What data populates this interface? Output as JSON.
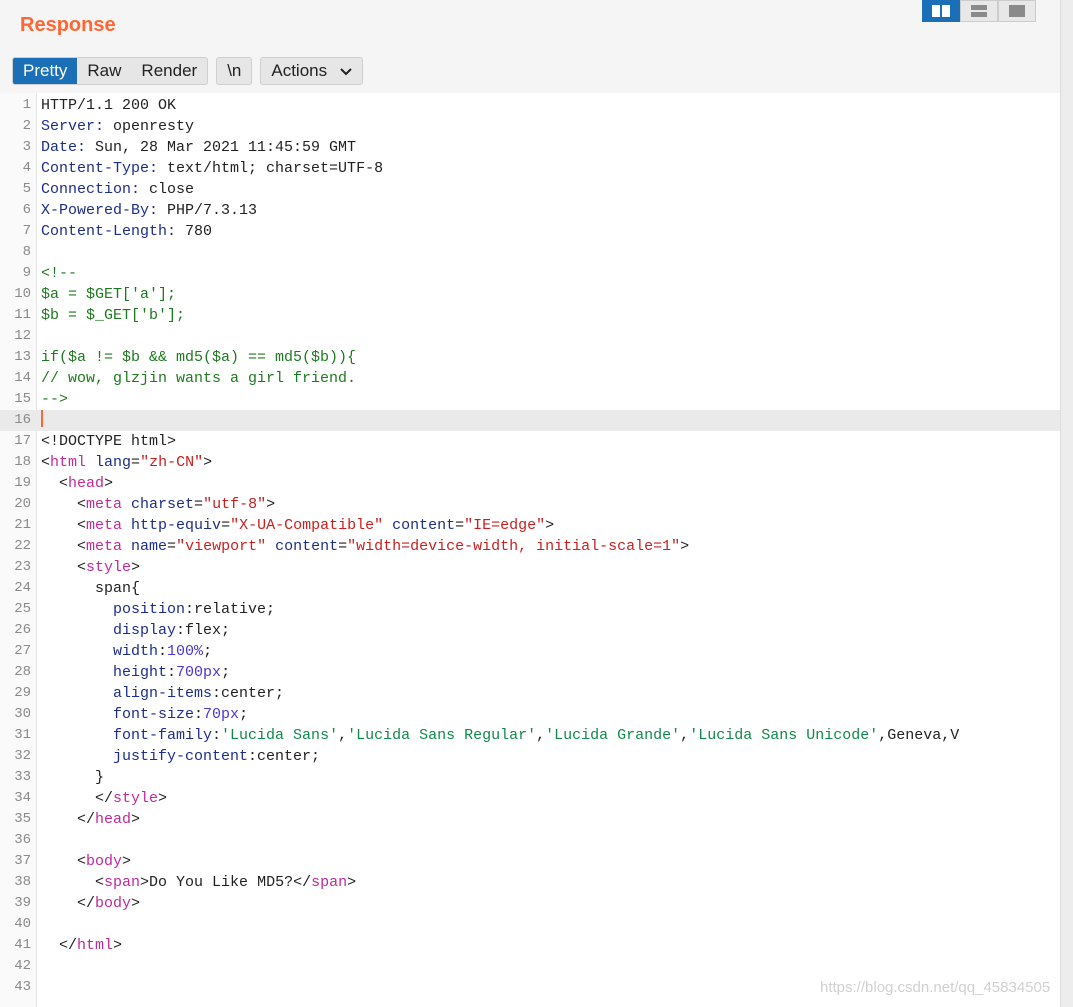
{
  "header": {
    "title": "Response",
    "layout_buttons": [
      "layout-columns-icon",
      "layout-rows-icon",
      "layout-single-icon"
    ]
  },
  "tabs": {
    "pretty": "Pretty",
    "raw": "Raw",
    "render": "Render",
    "newline": "\\n",
    "actions": "Actions"
  },
  "colors": {
    "accent": "#ff6633",
    "active_tab": "#1a6fb6"
  },
  "editor": {
    "current_line": 16,
    "lines": [
      {
        "n": "1",
        "segs": [
          [
            "t-txt",
            "HTTP/1.1 200 OK"
          ]
        ]
      },
      {
        "n": "2",
        "segs": [
          [
            "t-hkey",
            "Server:"
          ],
          [
            "t-txt",
            " openresty"
          ]
        ]
      },
      {
        "n": "3",
        "segs": [
          [
            "t-hkey",
            "Date:"
          ],
          [
            "t-txt",
            " Sun, 28 Mar 2021 11:45:59 GMT"
          ]
        ]
      },
      {
        "n": "4",
        "segs": [
          [
            "t-hkey",
            "Content-Type:"
          ],
          [
            "t-txt",
            " text/html; charset=UTF-8"
          ]
        ]
      },
      {
        "n": "5",
        "segs": [
          [
            "t-hkey",
            "Connection:"
          ],
          [
            "t-txt",
            " close"
          ]
        ]
      },
      {
        "n": "6",
        "segs": [
          [
            "t-hkey",
            "X-Powered-By:"
          ],
          [
            "t-txt",
            " PHP/7.3.13"
          ]
        ]
      },
      {
        "n": "7",
        "segs": [
          [
            "t-hkey",
            "Content-Length:"
          ],
          [
            "t-txt",
            " 780"
          ]
        ]
      },
      {
        "n": "8",
        "segs": []
      },
      {
        "n": "9",
        "segs": [
          [
            "t-com",
            "<!--"
          ]
        ]
      },
      {
        "n": "10",
        "segs": [
          [
            "t-com",
            "$a = $GET['a'];"
          ]
        ]
      },
      {
        "n": "11",
        "segs": [
          [
            "t-com",
            "$b = $_GET['b'];"
          ]
        ]
      },
      {
        "n": "12",
        "segs": []
      },
      {
        "n": "13",
        "segs": [
          [
            "t-com",
            "if($a != $b && md5($a) == md5($b)){"
          ]
        ]
      },
      {
        "n": "14",
        "segs": [
          [
            "t-com",
            "// wow, glzjin wants a girl friend."
          ]
        ]
      },
      {
        "n": "15",
        "segs": [
          [
            "t-com",
            "-->"
          ]
        ]
      },
      {
        "n": "16",
        "segs": []
      },
      {
        "n": "17",
        "segs": [
          [
            "t-pun",
            "<!DOCTYPE html>"
          ]
        ]
      },
      {
        "n": "18",
        "segs": [
          [
            "t-pun",
            "<"
          ],
          [
            "t-tag",
            "html"
          ],
          [
            "t-attr",
            " lang"
          ],
          [
            "t-pun",
            "="
          ],
          [
            "t-str",
            "\"zh-CN\""
          ],
          [
            "t-pun",
            ">"
          ]
        ]
      },
      {
        "n": "19",
        "segs": [
          [
            "t-pun",
            "  <"
          ],
          [
            "t-tag",
            "head"
          ],
          [
            "t-pun",
            ">"
          ]
        ]
      },
      {
        "n": "20",
        "segs": [
          [
            "t-pun",
            "    <"
          ],
          [
            "t-tag",
            "meta"
          ],
          [
            "t-attr",
            " charset"
          ],
          [
            "t-pun",
            "="
          ],
          [
            "t-str",
            "\"utf-8\""
          ],
          [
            "t-pun",
            ">"
          ]
        ]
      },
      {
        "n": "21",
        "segs": [
          [
            "t-pun",
            "    <"
          ],
          [
            "t-tag",
            "meta"
          ],
          [
            "t-attr",
            " http-equiv"
          ],
          [
            "t-pun",
            "="
          ],
          [
            "t-str",
            "\"X-UA-Compatible\""
          ],
          [
            "t-attr",
            " content"
          ],
          [
            "t-pun",
            "="
          ],
          [
            "t-str",
            "\"IE=edge\""
          ],
          [
            "t-pun",
            ">"
          ]
        ]
      },
      {
        "n": "22",
        "segs": [
          [
            "t-pun",
            "    <"
          ],
          [
            "t-tag",
            "meta"
          ],
          [
            "t-attr",
            " name"
          ],
          [
            "t-pun",
            "="
          ],
          [
            "t-str",
            "\"viewport\""
          ],
          [
            "t-attr",
            " content"
          ],
          [
            "t-pun",
            "="
          ],
          [
            "t-str",
            "\"width=device-width, initial-scale=1\""
          ],
          [
            "t-pun",
            ">"
          ]
        ]
      },
      {
        "n": "23",
        "segs": [
          [
            "t-pun",
            "    <"
          ],
          [
            "t-tag",
            "style"
          ],
          [
            "t-pun",
            ">"
          ]
        ]
      },
      {
        "n": "24",
        "segs": [
          [
            "t-txt",
            "      span{"
          ]
        ]
      },
      {
        "n": "25",
        "segs": [
          [
            "t-css",
            "        position"
          ],
          [
            "t-txt",
            ":relative;"
          ]
        ]
      },
      {
        "n": "26",
        "segs": [
          [
            "t-css",
            "        display"
          ],
          [
            "t-txt",
            ":flex;"
          ]
        ]
      },
      {
        "n": "27",
        "segs": [
          [
            "t-css",
            "        width"
          ],
          [
            "t-txt",
            ":"
          ],
          [
            "t-num",
            "100%"
          ],
          [
            "t-txt",
            ";"
          ]
        ]
      },
      {
        "n": "28",
        "segs": [
          [
            "t-css",
            "        height"
          ],
          [
            "t-txt",
            ":"
          ],
          [
            "t-num",
            "700px"
          ],
          [
            "t-txt",
            ";"
          ]
        ]
      },
      {
        "n": "29",
        "segs": [
          [
            "t-css",
            "        align-items"
          ],
          [
            "t-txt",
            ":center;"
          ]
        ]
      },
      {
        "n": "30",
        "segs": [
          [
            "t-css",
            "        font-size"
          ],
          [
            "t-txt",
            ":"
          ],
          [
            "t-num",
            "70px"
          ],
          [
            "t-txt",
            ";"
          ]
        ]
      },
      {
        "n": "31",
        "segs": [
          [
            "t-css",
            "        font-family"
          ],
          [
            "t-txt",
            ":"
          ],
          [
            "t-cstr",
            "'Lucida Sans'"
          ],
          [
            "t-txt",
            ","
          ],
          [
            "t-cstr",
            "'Lucida Sans Regular'"
          ],
          [
            "t-txt",
            ","
          ],
          [
            "t-cstr",
            "'Lucida Grande'"
          ],
          [
            "t-txt",
            ","
          ],
          [
            "t-cstr",
            "'Lucida Sans Unicode'"
          ],
          [
            "t-txt",
            ",Geneva,V"
          ]
        ]
      },
      {
        "n": "32",
        "segs": [
          [
            "t-css",
            "        justify-content"
          ],
          [
            "t-txt",
            ":center;"
          ]
        ]
      },
      {
        "n": "33",
        "segs": [
          [
            "t-txt",
            "      }"
          ]
        ]
      },
      {
        "n": "34",
        "segs": [
          [
            "t-pun",
            "      </"
          ],
          [
            "t-tag",
            "style"
          ],
          [
            "t-pun",
            ">"
          ]
        ]
      },
      {
        "n": "35",
        "segs": [
          [
            "t-pun",
            "    </"
          ],
          [
            "t-tag",
            "head"
          ],
          [
            "t-pun",
            ">"
          ]
        ]
      },
      {
        "n": "36",
        "segs": []
      },
      {
        "n": "37",
        "segs": [
          [
            "t-pun",
            "    <"
          ],
          [
            "t-tag",
            "body"
          ],
          [
            "t-pun",
            ">"
          ]
        ]
      },
      {
        "n": "38",
        "segs": [
          [
            "t-pun",
            "      <"
          ],
          [
            "t-tag",
            "span"
          ],
          [
            "t-pun",
            ">"
          ],
          [
            "t-txt",
            "Do You Like MD5?"
          ],
          [
            "t-pun",
            "</"
          ],
          [
            "t-tag",
            "span"
          ],
          [
            "t-pun",
            ">"
          ]
        ]
      },
      {
        "n": "39",
        "segs": [
          [
            "t-pun",
            "    </"
          ],
          [
            "t-tag",
            "body"
          ],
          [
            "t-pun",
            ">"
          ]
        ]
      },
      {
        "n": "40",
        "segs": []
      },
      {
        "n": "41",
        "segs": [
          [
            "t-pun",
            "  </"
          ],
          [
            "t-tag",
            "html"
          ],
          [
            "t-pun",
            ">"
          ]
        ]
      },
      {
        "n": "42",
        "segs": []
      },
      {
        "n": "43",
        "segs": []
      }
    ]
  },
  "watermark": "https://blog.csdn.net/qq_45834505"
}
